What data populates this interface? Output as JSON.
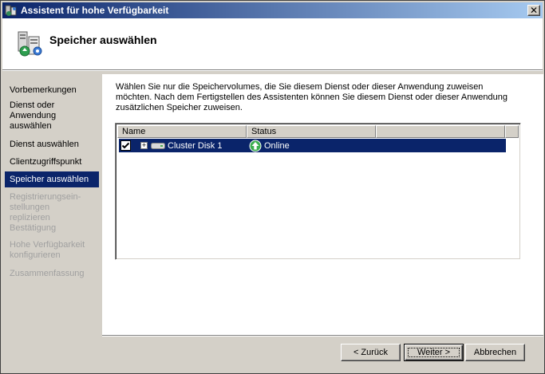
{
  "window": {
    "title": "Assistent für hohe Verfügbarkeit",
    "close_label": "✕"
  },
  "header": {
    "title": "Speicher auswählen",
    "icon": "cluster-wizard-icon"
  },
  "nav": {
    "items": [
      {
        "label": "Vorbemerkungen",
        "state": "normal"
      },
      {
        "label": "Dienst oder Anwendung auswählen",
        "state": "normal"
      },
      {
        "label": "Dienst auswählen",
        "state": "normal"
      },
      {
        "label": "Clientzugriffspunkt",
        "state": "normal"
      },
      {
        "label": "Speicher auswählen",
        "state": "active"
      },
      {
        "label": "Registrierungsein-stellungen replizieren",
        "state": "disabled"
      },
      {
        "label": "Bestätigung",
        "state": "disabled"
      },
      {
        "label": "Hohe Verfügbarkeit konfigurieren",
        "state": "disabled"
      },
      {
        "label": "Zusammenfassung",
        "state": "disabled"
      }
    ]
  },
  "main": {
    "description": "Wählen Sie nur die Speichervolumes, die Sie diesem Dienst oder dieser Anwendung zuweisen möchten. Nach dem Fertigstellen des Assistenten können Sie diesem Dienst oder dieser Anwendung zusätzlichen Speicher zuweisen.",
    "list": {
      "columns": [
        "Name",
        "Status",
        ""
      ],
      "rows": [
        {
          "name": "Cluster Disk 1",
          "status": "Online",
          "checked": true,
          "expand": "+"
        }
      ]
    }
  },
  "buttons": {
    "back": "< Zurück",
    "next": "Weiter >",
    "cancel": "Abbrechen"
  },
  "colors": {
    "selection": "#0a246a",
    "face": "#d4d0c8",
    "disabled_text": "#a0a0a0"
  }
}
